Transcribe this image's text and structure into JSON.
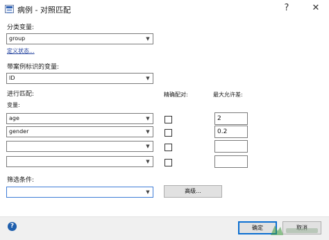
{
  "window": {
    "title": "病例 - 对照匹配",
    "help_glyph": "?",
    "close_glyph": "✕"
  },
  "category_var": {
    "label": "分类变量:",
    "value": "group",
    "define_status_link": "定义状态..."
  },
  "case_id_var": {
    "label": "带案例标识的变量:",
    "value": "ID"
  },
  "matching": {
    "section_label": "进行匹配:",
    "variables_header": "变量:",
    "exact_header": "精确配对:",
    "tolerance_header": "最大允许差:",
    "rows": [
      {
        "variable": "age",
        "tolerance": "2"
      },
      {
        "variable": "gender",
        "tolerance": "0.2"
      },
      {
        "variable": "",
        "tolerance": ""
      },
      {
        "variable": "",
        "tolerance": ""
      }
    ]
  },
  "filter": {
    "label": "筛选条件:",
    "value": "",
    "advanced_button": "高级..."
  },
  "footer": {
    "help_icon": "question-circle-icon",
    "ok_button": "确定",
    "cancel_button": "取消"
  },
  "colors": {
    "link": "#1f3f9c",
    "focus_border": "#3c7bd6",
    "primary_border": "#0a6ed1",
    "help_icon": "#1f5fad"
  }
}
